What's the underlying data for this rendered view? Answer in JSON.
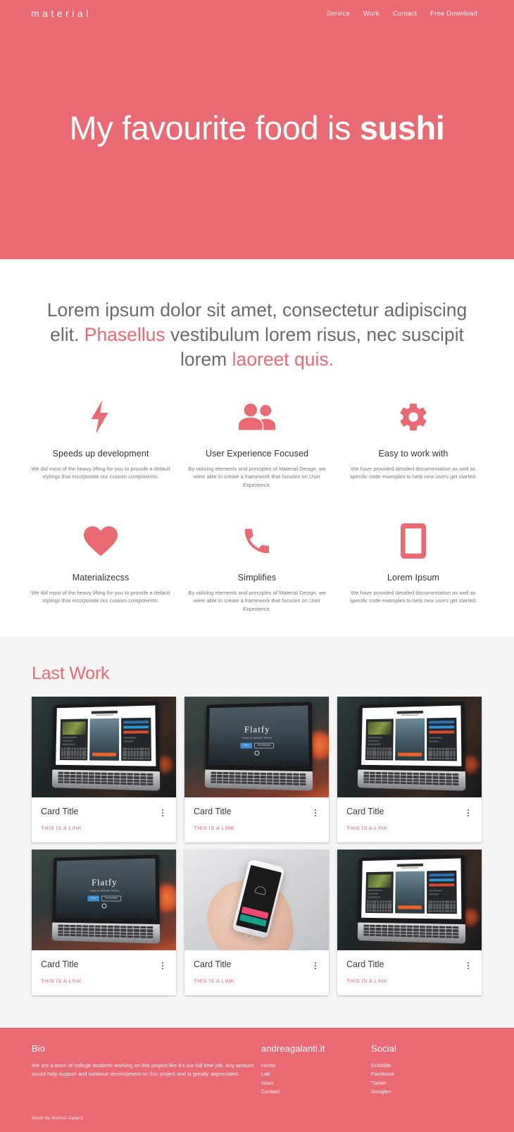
{
  "navbar": {
    "logo": "material",
    "links": [
      {
        "label": "Service"
      },
      {
        "label": "Work"
      },
      {
        "label": "Contact"
      },
      {
        "label": "Free Download"
      }
    ]
  },
  "hero": {
    "title_normal": "My favourite food is ",
    "title_strong": "sushi"
  },
  "intro": {
    "part1": "Lorem ipsum dolor sit amet, consectetur adipiscing elit. ",
    "highlight1": "Phasellus",
    "part2": " vestibulum lorem risus, nec suscipit lorem ",
    "highlight2": "laoreet quis."
  },
  "features": {
    "rows": [
      [
        {
          "icon": "flash-icon",
          "title": "Speeds up development",
          "desc": "We did most of the heavy lifting for you to provide a default stylings that incorporate our custom components."
        },
        {
          "icon": "group-icon",
          "title": "User Experience Focused",
          "desc": "By utilizing elements and principles of Material Design, we were able to create a framework that focuses on User Experience."
        },
        {
          "icon": "settings-gear-icon",
          "title": "Easy to work with",
          "desc": "We have provided detailed documentation as well as specific code examples to help new users get started."
        }
      ],
      [
        {
          "icon": "heart-icon",
          "title": "Materializecss",
          "desc": "We did most of the heavy lifting for you to provide a default stylings that incorporate our custom components."
        },
        {
          "icon": "phone-call-icon",
          "title": "Simplifies",
          "desc": "By utilizing elements and principles of Material Design, we were able to create a framework that focuses on User Experience."
        },
        {
          "icon": "tablet-icon",
          "title": "Lorem Ipsum",
          "desc": "We have provided detailed documentation as well as specific code examples to help new users get started."
        }
      ]
    ]
  },
  "work": {
    "title": "Last Work",
    "cards": [
      {
        "art": "screenapp",
        "title": "Card Title",
        "link": "THIS IS A LINK",
        "menu_icon": "more-vert-icon"
      },
      {
        "art": "flatfy",
        "title": "Card Title",
        "link": "THIS IS A LINK",
        "menu_icon": "more-vert-icon"
      },
      {
        "art": "screenapp",
        "title": "Card Title",
        "link": "THIS IS A LINK",
        "menu_icon": "more-vert-icon"
      },
      {
        "art": "flatfy",
        "title": "Card Title",
        "link": "THIS IS A LINK",
        "menu_icon": "more-vert-icon"
      },
      {
        "art": "phone",
        "title": "Card Title",
        "link": "THIS IS A LINK",
        "menu_icon": "more-vert-icon"
      },
      {
        "art": "screenapp",
        "title": "Card Title",
        "link": "THIS IS A LINK",
        "menu_icon": "more-vert-icon"
      }
    ],
    "card_art_text": {
      "screenapp_title": "Screen App",
      "flatfy_title": "Flatfy",
      "flatfy_sub": "Clean & minimal Theme",
      "flatfy_btn_primary": "Demo",
      "flatfy_btn_secondary": "Free Download"
    }
  },
  "footer": {
    "bio": {
      "heading": "Bio",
      "text": "We are a team of college students working on this project like it's our full time job. Any amount would help support and continue development on this project and is greatly appreciated."
    },
    "site": {
      "heading": "andreagalanti.it",
      "links": [
        {
          "label": "Home"
        },
        {
          "label": "Lab"
        },
        {
          "label": "Work"
        },
        {
          "label": "Contact"
        }
      ]
    },
    "social": {
      "heading": "Social",
      "links": [
        {
          "label": "Dribbble"
        },
        {
          "label": "Facebook"
        },
        {
          "label": "Twitter"
        },
        {
          "label": "Google+"
        }
      ]
    },
    "made_by": "Made by Andrea Galanti"
  },
  "colors": {
    "brand": "#ea6a73",
    "work_bg": "#f5f5f5",
    "text_dark": "#333333",
    "text_muted": "#7a7a7a"
  }
}
